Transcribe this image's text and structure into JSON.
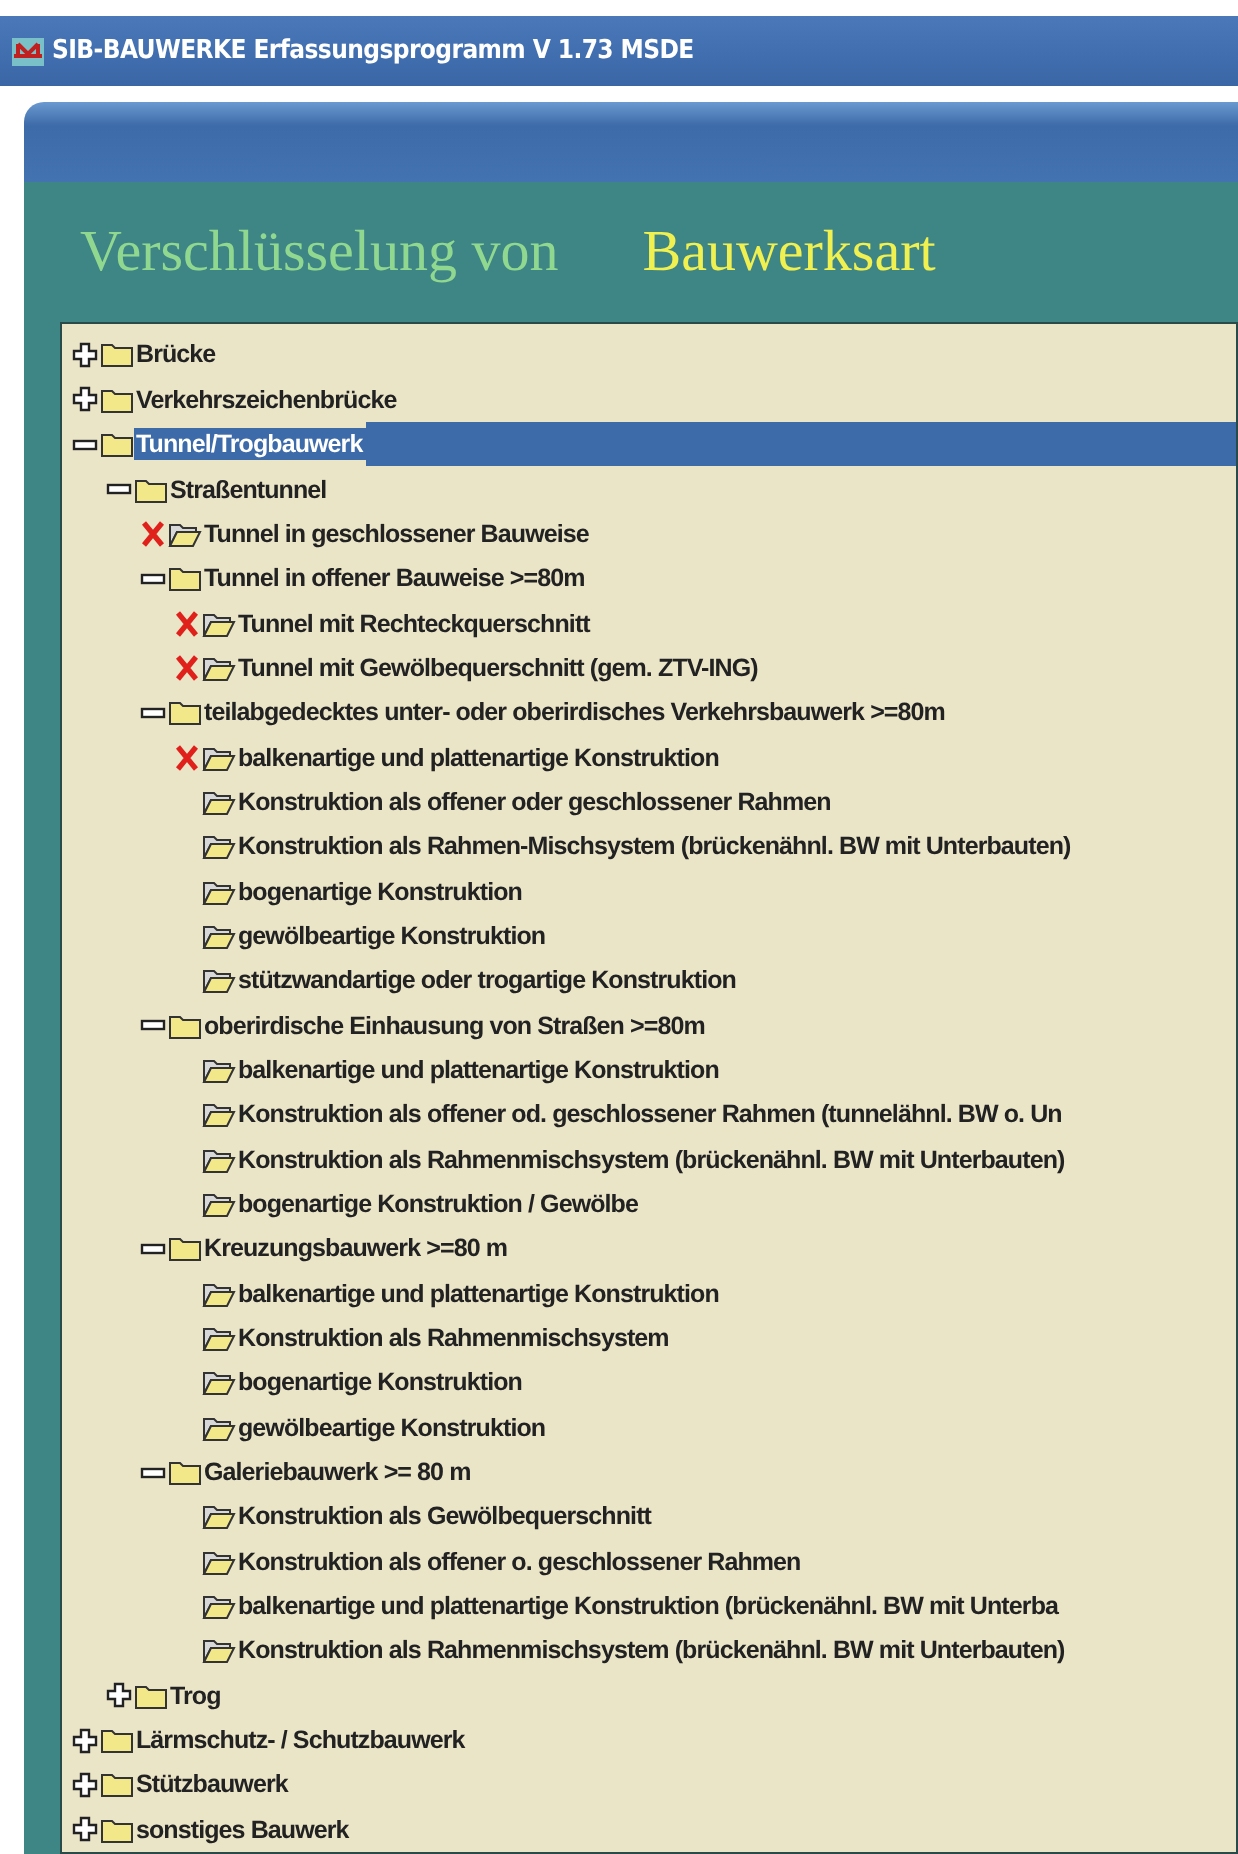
{
  "window": {
    "title": "SIB-BAUWERKE Erfassungsprogramm V 1.73 MSDE"
  },
  "heading": {
    "label": "Verschlüsselung von",
    "value": "Bauwerksart"
  },
  "tree": [
    {
      "label": "Brücke",
      "kind": "group",
      "expanded": false,
      "selected": false
    },
    {
      "label": "Verkehrszeichenbrücke",
      "kind": "group",
      "expanded": false,
      "selected": false
    },
    {
      "label": "Tunnel/Trogbauwerk",
      "kind": "group",
      "expanded": true,
      "selected": true,
      "children": [
        {
          "label": "Straßentunnel",
          "kind": "group",
          "expanded": true,
          "selected": false,
          "children": [
            {
              "label": "Tunnel in geschlossener Bauweise",
              "kind": "leaf",
              "crossed": true,
              "selected": false
            },
            {
              "label": "Tunnel in offener Bauweise >=80m",
              "kind": "group",
              "expanded": true,
              "selected": false,
              "children": [
                {
                  "label": "Tunnel mit Rechteckquerschnitt",
                  "kind": "leaf",
                  "crossed": true,
                  "selected": false
                },
                {
                  "label": "Tunnel mit Gewölbequerschnitt (gem. ZTV-ING)",
                  "kind": "leaf",
                  "crossed": true,
                  "selected": false
                }
              ]
            },
            {
              "label": "teilabgedecktes unter- oder oberirdisches Verkehrsbauwerk >=80m",
              "kind": "group",
              "expanded": true,
              "selected": false,
              "children": [
                {
                  "label": "balkenartige und plattenartige Konstruktion",
                  "kind": "leaf",
                  "crossed": true,
                  "selected": false
                },
                {
                  "label": "Konstruktion als offener oder geschlossener Rahmen",
                  "kind": "leaf",
                  "crossed": false,
                  "selected": false
                },
                {
                  "label": "Konstruktion als Rahmen-Mischsystem (brückenähnl. BW mit Unterbauten)",
                  "kind": "leaf",
                  "crossed": false,
                  "selected": false
                },
                {
                  "label": "bogenartige Konstruktion",
                  "kind": "leaf",
                  "crossed": false,
                  "selected": false
                },
                {
                  "label": "gewölbeartige Konstruktion",
                  "kind": "leaf",
                  "crossed": false,
                  "selected": false
                },
                {
                  "label": "stützwandartige oder trogartige Konstruktion",
                  "kind": "leaf",
                  "crossed": false,
                  "selected": false
                }
              ]
            },
            {
              "label": "oberirdische Einhausung von Straßen >=80m",
              "kind": "group",
              "expanded": true,
              "selected": false,
              "children": [
                {
                  "label": "balkenartige und plattenartige Konstruktion",
                  "kind": "leaf",
                  "crossed": false,
                  "selected": false
                },
                {
                  "label": "Konstruktion als offener od. geschlossener Rahmen (tunnelähnl. BW o. Un",
                  "kind": "leaf",
                  "crossed": false,
                  "selected": false
                },
                {
                  "label": "Konstruktion als Rahmenmischsystem (brückenähnl. BW mit Unterbauten)",
                  "kind": "leaf",
                  "crossed": false,
                  "selected": false
                },
                {
                  "label": "bogenartige Konstruktion / Gewölbe",
                  "kind": "leaf",
                  "crossed": false,
                  "selected": false
                }
              ]
            },
            {
              "label": "Kreuzungsbauwerk >=80 m",
              "kind": "group",
              "expanded": true,
              "selected": false,
              "children": [
                {
                  "label": "balkenartige und plattenartige Konstruktion",
                  "kind": "leaf",
                  "crossed": false,
                  "selected": false
                },
                {
                  "label": "Konstruktion als Rahmenmischsystem",
                  "kind": "leaf",
                  "crossed": false,
                  "selected": false
                },
                {
                  "label": "bogenartige Konstruktion",
                  "kind": "leaf",
                  "crossed": false,
                  "selected": false
                },
                {
                  "label": "gewölbeartige Konstruktion",
                  "kind": "leaf",
                  "crossed": false,
                  "selected": false
                }
              ]
            },
            {
              "label": "Galeriebauwerk >= 80 m",
              "kind": "group",
              "expanded": true,
              "selected": false,
              "children": [
                {
                  "label": "Konstruktion als Gewölbequerschnitt",
                  "kind": "leaf",
                  "crossed": false,
                  "selected": false
                },
                {
                  "label": "Konstruktion als offener o. geschlossener Rahmen",
                  "kind": "leaf",
                  "crossed": false,
                  "selected": false
                },
                {
                  "label": "balkenartige und plattenartige Konstruktion (brückenähnl. BW mit Unterba",
                  "kind": "leaf",
                  "crossed": false,
                  "selected": false
                },
                {
                  "label": "Konstruktion als Rahmenmischsystem (brückenähnl. BW mit Unterbauten)",
                  "kind": "leaf",
                  "crossed": false,
                  "selected": false
                }
              ]
            }
          ]
        },
        {
          "label": "Trog",
          "kind": "group",
          "expanded": false,
          "selected": false
        }
      ]
    },
    {
      "label": "Lärmschutz- / Schutzbauwerk",
      "kind": "group",
      "expanded": false,
      "selected": false
    },
    {
      "label": "Stützbauwerk",
      "kind": "group",
      "expanded": false,
      "selected": false
    },
    {
      "label": "sonstiges Bauwerk",
      "kind": "group",
      "expanded": false,
      "selected": false
    }
  ]
}
